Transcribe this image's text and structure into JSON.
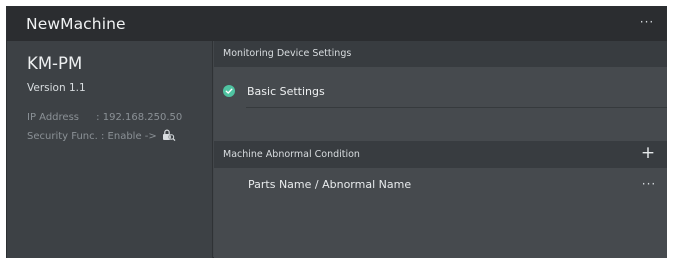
{
  "window": {
    "title": "NewMachine",
    "more_menu": "···"
  },
  "device": {
    "name": "KM-PM",
    "version": "Version 1.1",
    "ip_label": "IP Address",
    "ip_sep": " : ",
    "ip_value": "192.168.250.50",
    "security_label": "Security Func.",
    "security_sep": " : ",
    "security_value": "Enable",
    "security_arrow": " -> ",
    "security_icon": "lock-search-icon"
  },
  "monitoring": {
    "header": "Monitoring Device Settings",
    "items": [
      {
        "label": "Basic Settings",
        "status": "checked",
        "status_color": "#4fc3a1"
      }
    ]
  },
  "abnormal": {
    "header": "Machine Abnormal Condition",
    "add_label": "+",
    "columns_label": "Parts Name / Abnormal Name",
    "more_menu": "···"
  },
  "colors": {
    "titlebar": "#2b2d30",
    "panel": "#43474b",
    "section_header": "#383c40",
    "accent_check": "#4fc3a1"
  }
}
